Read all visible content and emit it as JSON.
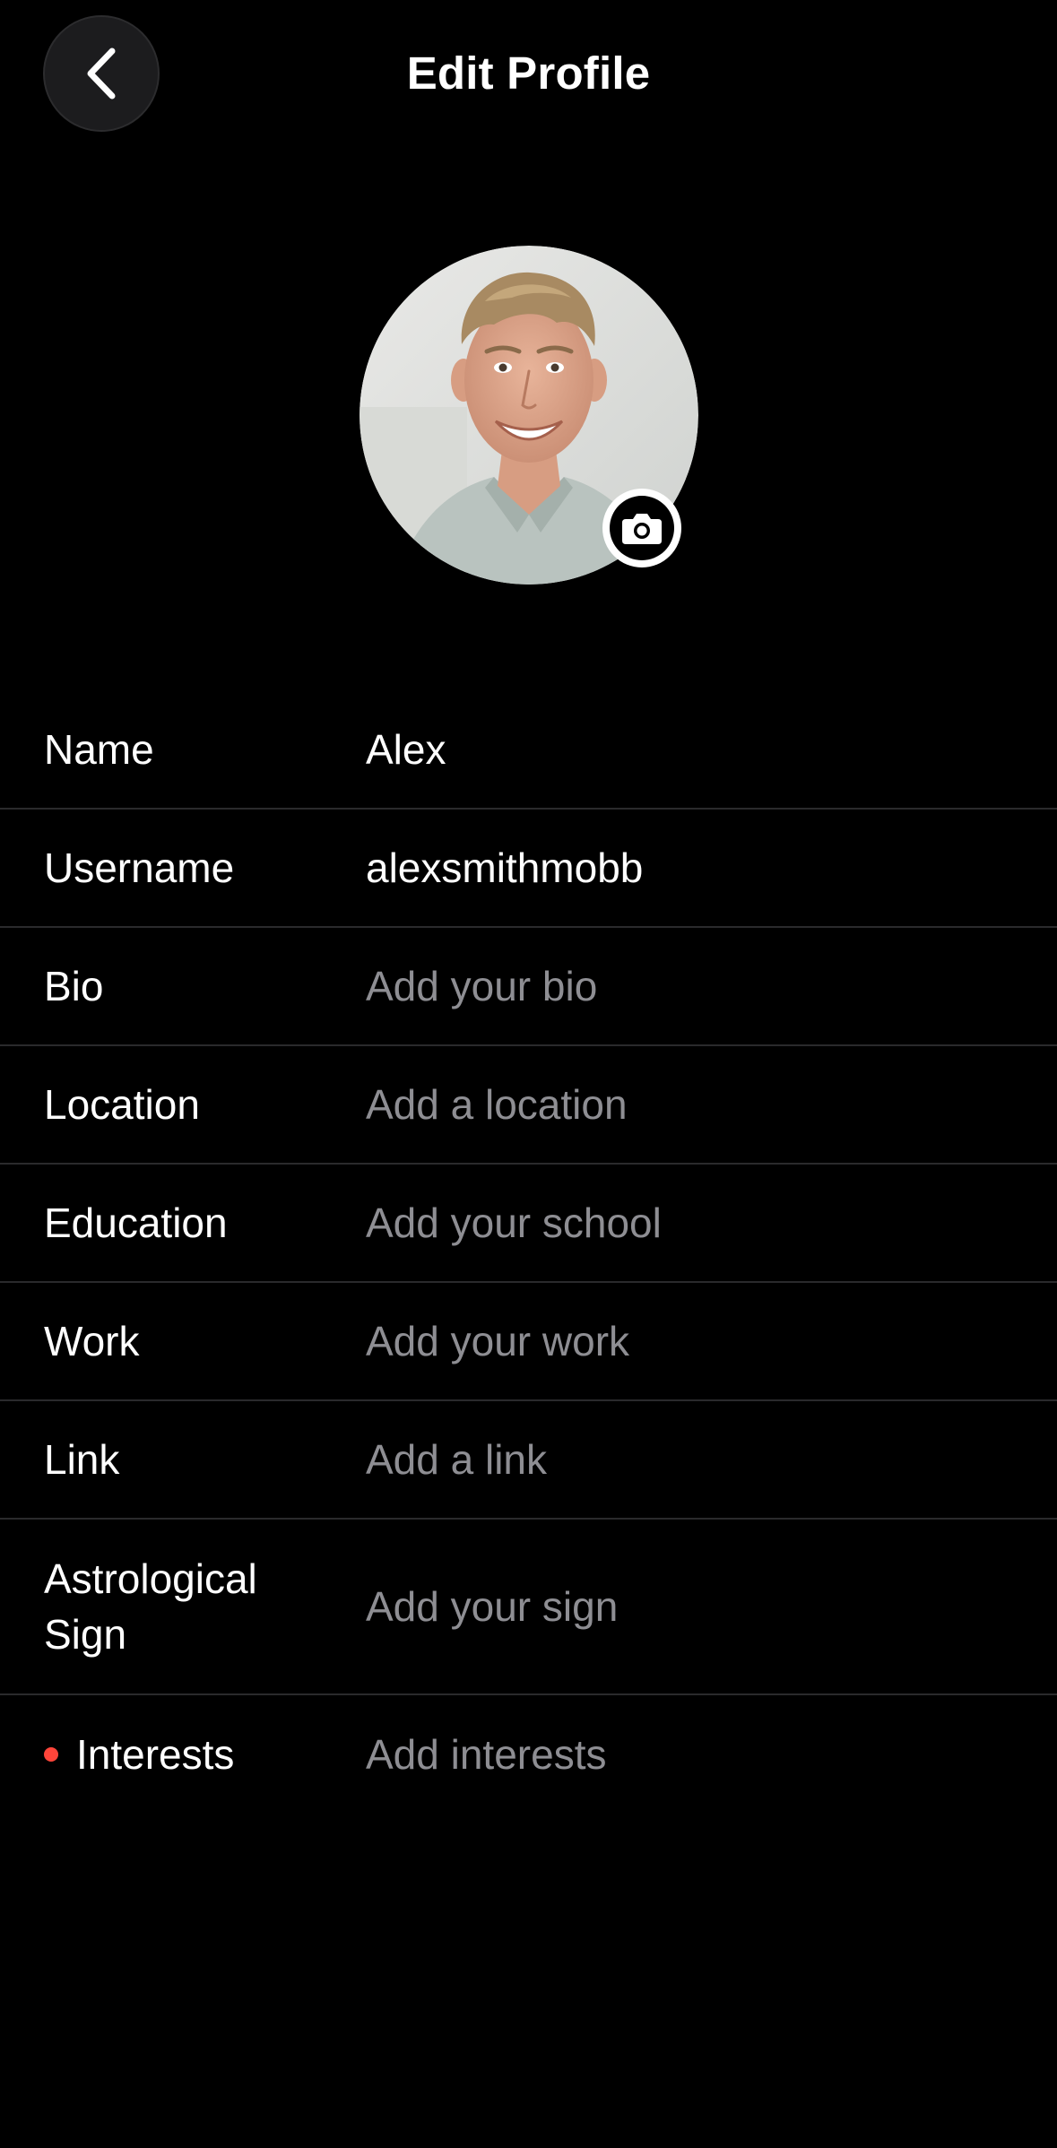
{
  "header": {
    "title": "Edit Profile",
    "back_icon": "chevron-left-icon"
  },
  "avatar": {
    "camera_icon": "camera-icon"
  },
  "fields": [
    {
      "label": "Name",
      "value": "Alex",
      "filled": true
    },
    {
      "label": "Username",
      "value": "alexsmithmobb",
      "filled": true
    },
    {
      "label": "Bio",
      "value": "Add your bio",
      "filled": false
    },
    {
      "label": "Location",
      "value": "Add a location",
      "filled": false
    },
    {
      "label": "Education",
      "value": "Add your school",
      "filled": false
    },
    {
      "label": "Work",
      "value": "Add your work",
      "filled": false
    },
    {
      "label": "Link",
      "value": "Add a link",
      "filled": false
    },
    {
      "label": "Astrological Sign",
      "value": "Add your sign",
      "filled": false
    },
    {
      "label": "Interests",
      "value": "Add interests",
      "filled": false,
      "indicator": "red-dot"
    }
  ],
  "colors": {
    "background": "#000000",
    "text": "#ffffff",
    "placeholder": "#8e8e93",
    "divider": "#2a2a2c",
    "indicator": "#ff453a"
  }
}
